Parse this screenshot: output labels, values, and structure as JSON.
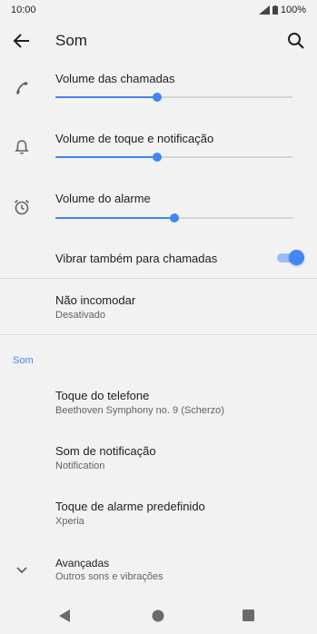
{
  "status_bar": {
    "time": "10:00",
    "battery": "100%"
  },
  "app_bar": {
    "title": "Som"
  },
  "volumes": [
    {
      "label": "Volume das chamadas",
      "level": 0.43
    },
    {
      "label": "Volume de toque e notificação",
      "level": 0.43
    },
    {
      "label": "Volume do alarme",
      "level": 0.5
    }
  ],
  "vibrate": {
    "label": "Vibrar também para chamadas",
    "enabled": true
  },
  "dnd": {
    "label": "Não incomodar",
    "value": "Desativado"
  },
  "section": {
    "header": "Som"
  },
  "items": [
    {
      "label": "Toque do telefone",
      "value": "Beethoven Symphony no. 9 (Scherzo)"
    },
    {
      "label": "Som de notificação",
      "value": "Notification"
    },
    {
      "label": "Toque de alarme predefinido",
      "value": "Xperia"
    }
  ],
  "advanced": {
    "label": "Avançadas",
    "value": "Outros sons e vibrações"
  },
  "colors": {
    "accent": "#4285f4",
    "background": "#f2f2f2"
  }
}
